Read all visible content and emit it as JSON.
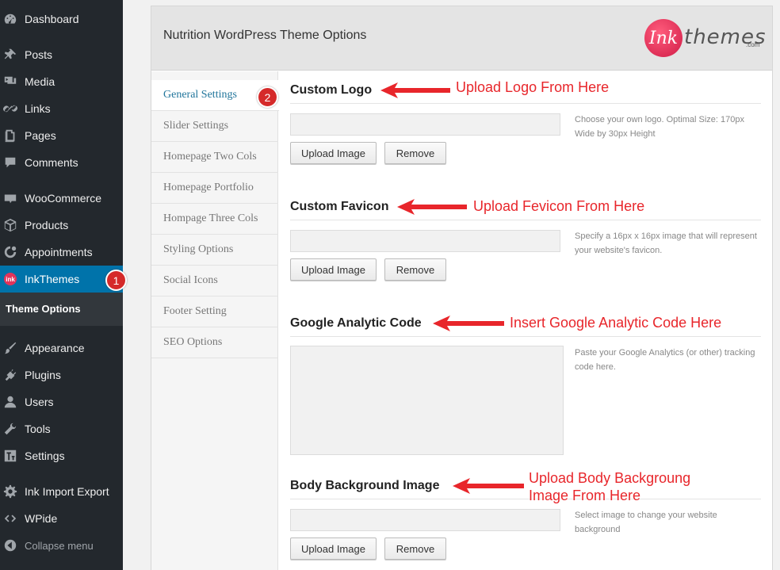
{
  "sidebar": {
    "items": [
      {
        "label": "Dashboard",
        "icon": "dashboard-icon"
      },
      {
        "label": "Posts",
        "icon": "pin-icon"
      },
      {
        "label": "Media",
        "icon": "media-icon"
      },
      {
        "label": "Links",
        "icon": "link-icon"
      },
      {
        "label": "Pages",
        "icon": "pages-icon"
      },
      {
        "label": "Comments",
        "icon": "comment-icon"
      },
      {
        "label": "WooCommerce",
        "icon": "woocommerce-icon"
      },
      {
        "label": "Products",
        "icon": "box-icon"
      },
      {
        "label": "Appointments",
        "icon": "appointments-icon"
      },
      {
        "label": "InkThemes",
        "icon": "inkthemes-icon"
      },
      {
        "label": "Appearance",
        "icon": "brush-icon"
      },
      {
        "label": "Plugins",
        "icon": "plugin-icon"
      },
      {
        "label": "Users",
        "icon": "user-icon"
      },
      {
        "label": "Tools",
        "icon": "wrench-icon"
      },
      {
        "label": "Settings",
        "icon": "settings-icon"
      },
      {
        "label": "Ink Import Export",
        "icon": "gear-icon"
      },
      {
        "label": "WPide",
        "icon": "code-icon"
      },
      {
        "label": "Collapse menu",
        "icon": "collapse-icon"
      }
    ],
    "submenu": {
      "label": "Theme Options"
    },
    "badge": "1"
  },
  "panel": {
    "title": "Nutrition WordPress Theme Options",
    "brand": {
      "mark": "Ink",
      "word": "themes",
      "domain": ".com"
    }
  },
  "tabs": [
    "General Settings",
    "Slider Settings",
    "Homepage Two Cols",
    "Homepage Portfolio",
    "Hompage Three Cols",
    "Styling Options",
    "Social Icons",
    "Footer Setting",
    "SEO Options"
  ],
  "tab_badge": "2",
  "sections": {
    "logo": {
      "title": "Custom Logo",
      "hint": "Choose your own logo. Optimal Size: 170px Wide by 30px Height",
      "upload": "Upload Image",
      "remove": "Remove",
      "annotation": "Upload Logo From Here"
    },
    "favicon": {
      "title": "Custom Favicon",
      "hint": "Specify a 16px x 16px image that will represent your website's favicon.",
      "upload": "Upload Image",
      "remove": "Remove",
      "annotation": "Upload Fevicon From Here"
    },
    "analytics": {
      "title": "Google Analytic Code",
      "hint": "Paste your Google Analytics (or other) tracking code here.",
      "annotation": "Insert Google Analytic Code Here"
    },
    "background": {
      "title": "Body Background Image",
      "hint": "Select image to change your website background",
      "upload": "Upload Image",
      "remove": "Remove",
      "annotation_line1": "Upload Body Backgroung",
      "annotation_line2": "Image From Here"
    }
  },
  "colors": {
    "sidebar_bg": "#23282d",
    "active_bg": "#0073aa",
    "annotation": "#e8262b",
    "tab_active_text": "#21759b"
  }
}
